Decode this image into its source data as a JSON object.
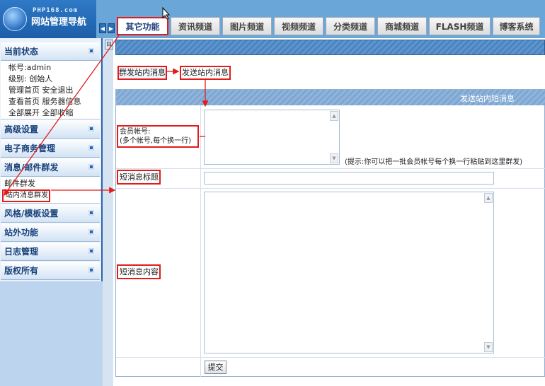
{
  "logo": {
    "small_text": "PHP168.com",
    "title": "网站管理导航"
  },
  "top_tabs": [
    {
      "label": "其它功能",
      "active": true
    },
    {
      "label": "资讯频道"
    },
    {
      "label": "图片频道"
    },
    {
      "label": "视频频道"
    },
    {
      "label": "分类频道"
    },
    {
      "label": "商城频道"
    },
    {
      "label": "FLASH频道"
    },
    {
      "label": "博客系统"
    }
  ],
  "sidebar": {
    "current_status": {
      "header": "当前状态",
      "account": "帐号:admin",
      "level": "级别: 创始人",
      "links1": "管理首页 安全退出",
      "links2": "查看首页 服务器信息",
      "links3": "全部展开 全部收缩"
    },
    "advanced": "高级设置",
    "ecommerce": "电子商务管理",
    "messaging": {
      "header": "消息/邮件群发",
      "items": [
        "邮件群发",
        "站内消息群发"
      ]
    },
    "style_template": "风格/模板设置",
    "external": "站外功能",
    "log": "日志管理",
    "copyright": "版权所有"
  },
  "actions": {
    "group_send": "群发站内消息",
    "send_msg": "发送站内消息"
  },
  "form": {
    "header": "发送站内短消息",
    "members_label_1": "会员帐号:",
    "members_label_2": "(多个帐号,每个换一行)",
    "hint": "(提示:你可以把一批会员帐号每个换一行粘贴到这里群发)",
    "title_label": "短消息标题",
    "content_label": "短消息内容",
    "submit": "提交"
  },
  "colors": {
    "accent_red": "#e31b1b",
    "brand_blue": "#2f79c6"
  }
}
